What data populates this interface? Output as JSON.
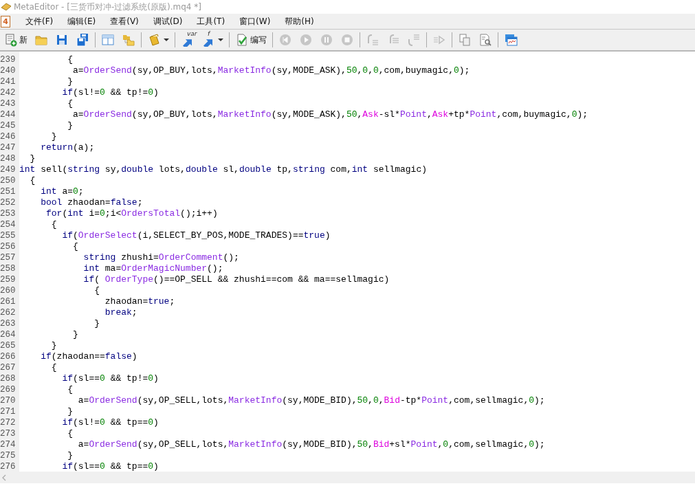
{
  "window": {
    "title": "MetaEditor - [三货币对冲-过滤系统(原版).mq4 *]",
    "active": false
  },
  "menu_bar": {
    "app_icon_text": "4",
    "items": [
      {
        "label": "文件(F)"
      },
      {
        "label": "编辑(E)"
      },
      {
        "label": "查看(V)"
      },
      {
        "label": "调试(D)"
      },
      {
        "label": "工具(T)"
      },
      {
        "label": "窗口(W)"
      },
      {
        "label": "帮助(H)"
      }
    ]
  },
  "toolbar": {
    "groups": [
      [
        {
          "label": "新",
          "disabled": false,
          "dropdown": false
        },
        {
          "disabled": false,
          "dropdown": false
        },
        {
          "disabled": false,
          "dropdown": false
        },
        {
          "disabled": false,
          "dropdown": false
        }
      ],
      [
        {
          "disabled": false,
          "dropdown": false
        },
        {
          "disabled": false,
          "dropdown": false
        }
      ],
      [
        {
          "disabled": false,
          "dropdown": true
        }
      ],
      [
        {
          "icon_text": "var",
          "disabled": false,
          "dropdown": false
        },
        {
          "icon_text": "f",
          "disabled": false,
          "dropdown": true
        }
      ],
      [
        {
          "label": "编写",
          "disabled": false,
          "dropdown": false
        }
      ],
      [
        {
          "disabled": true,
          "dropdown": false
        },
        {
          "disabled": true,
          "dropdown": false
        },
        {
          "disabled": true,
          "dropdown": false
        },
        {
          "disabled": true,
          "dropdown": false
        }
      ],
      [
        {
          "disabled": true,
          "dropdown": false
        },
        {
          "disabled": true,
          "dropdown": false
        },
        {
          "disabled": true,
          "dropdown": false
        }
      ],
      [
        {
          "disabled": true,
          "dropdown": false
        }
      ],
      [
        {
          "disabled": false,
          "dropdown": false
        },
        {
          "disabled": false,
          "dropdown": false
        }
      ],
      [
        {
          "disabled": false,
          "dropdown": false
        }
      ]
    ]
  },
  "editor": {
    "lines": [
      {
        "number": "239",
        "tokens": [
          {
            "kind": "plain",
            "text": "{"
          }
        ]
      },
      {
        "number": "240",
        "tokens": [
          {
            "kind": "plain",
            "text": "a="
          },
          {
            "kind": "function",
            "text": "OrderSend"
          },
          {
            "kind": "plain",
            "text": "(sy,OP_BUY,lots,"
          },
          {
            "kind": "function",
            "text": "MarketInfo"
          },
          {
            "kind": "plain",
            "text": "(sy,MODE_ASK),"
          },
          {
            "kind": "number",
            "text": "50"
          },
          {
            "kind": "plain",
            "text": ","
          },
          {
            "kind": "number",
            "text": "0"
          },
          {
            "kind": "plain",
            "text": ","
          },
          {
            "kind": "number",
            "text": "0"
          },
          {
            "kind": "plain",
            "text": ",com,buymagic,"
          },
          {
            "kind": "number",
            "text": "0"
          },
          {
            "kind": "plain",
            "text": ");"
          }
        ]
      },
      {
        "number": "241",
        "tokens": [
          {
            "kind": "plain",
            "text": "}"
          }
        ]
      },
      {
        "number": "242",
        "tokens": [
          {
            "kind": "keyword",
            "text": "if"
          },
          {
            "kind": "plain",
            "text": "(sl!="
          },
          {
            "kind": "number",
            "text": "0"
          },
          {
            "kind": "plain",
            "text": " && tp!="
          },
          {
            "kind": "number",
            "text": "0"
          },
          {
            "kind": "plain",
            "text": ")"
          }
        ]
      },
      {
        "number": "243",
        "tokens": [
          {
            "kind": "plain",
            "text": "{"
          }
        ]
      },
      {
        "number": "244",
        "tokens": [
          {
            "kind": "plain",
            "text": "a="
          },
          {
            "kind": "function",
            "text": "OrderSend"
          },
          {
            "kind": "plain",
            "text": "(sy,OP_BUY,lots,"
          },
          {
            "kind": "function",
            "text": "MarketInfo"
          },
          {
            "kind": "plain",
            "text": "(sy,MODE_ASK),"
          },
          {
            "kind": "number",
            "text": "50"
          },
          {
            "kind": "plain",
            "text": ","
          },
          {
            "kind": "variable",
            "text": "Ask"
          },
          {
            "kind": "plain",
            "text": "-sl*"
          },
          {
            "kind": "function",
            "text": "Point"
          },
          {
            "kind": "plain",
            "text": ","
          },
          {
            "kind": "variable",
            "text": "Ask"
          },
          {
            "kind": "plain",
            "text": "+tp*"
          },
          {
            "kind": "function",
            "text": "Point"
          },
          {
            "kind": "plain",
            "text": ",com,buymagic,"
          },
          {
            "kind": "number",
            "text": "0"
          },
          {
            "kind": "plain",
            "text": ");"
          }
        ]
      },
      {
        "number": "245",
        "tokens": [
          {
            "kind": "plain",
            "text": "}"
          }
        ]
      },
      {
        "number": "246",
        "tokens": [
          {
            "kind": "plain",
            "text": "}"
          }
        ]
      },
      {
        "number": "247",
        "tokens": [
          {
            "kind": "keyword",
            "text": "return"
          },
          {
            "kind": "plain",
            "text": "(a);"
          }
        ]
      },
      {
        "number": "248",
        "tokens": [
          {
            "kind": "plain",
            "text": "}"
          }
        ]
      },
      {
        "number": "249",
        "tokens": [
          {
            "kind": "keyword",
            "text": "int"
          },
          {
            "kind": "plain",
            "text": " sell("
          },
          {
            "kind": "keyword",
            "text": "string"
          },
          {
            "kind": "plain",
            "text": " sy,"
          },
          {
            "kind": "keyword",
            "text": "double"
          },
          {
            "kind": "plain",
            "text": " lots,"
          },
          {
            "kind": "keyword",
            "text": "double"
          },
          {
            "kind": "plain",
            "text": " sl,"
          },
          {
            "kind": "keyword",
            "text": "double"
          },
          {
            "kind": "plain",
            "text": " tp,"
          },
          {
            "kind": "keyword",
            "text": "string"
          },
          {
            "kind": "plain",
            "text": " com,"
          },
          {
            "kind": "keyword",
            "text": "int"
          },
          {
            "kind": "plain",
            "text": " sellmagic)"
          }
        ]
      },
      {
        "number": "250",
        "tokens": [
          {
            "kind": "plain",
            "text": "{"
          }
        ]
      },
      {
        "number": "251",
        "tokens": [
          {
            "kind": "keyword",
            "text": "int"
          },
          {
            "kind": "plain",
            "text": " a="
          },
          {
            "kind": "number",
            "text": "0"
          },
          {
            "kind": "plain",
            "text": ";"
          }
        ]
      },
      {
        "number": "252",
        "tokens": [
          {
            "kind": "keyword",
            "text": "bool"
          },
          {
            "kind": "plain",
            "text": " zhaodan="
          },
          {
            "kind": "keyword",
            "text": "false"
          },
          {
            "kind": "plain",
            "text": ";"
          }
        ]
      },
      {
        "number": "253",
        "tokens": [
          {
            "kind": "keyword",
            "text": "for"
          },
          {
            "kind": "plain",
            "text": "("
          },
          {
            "kind": "keyword",
            "text": "int"
          },
          {
            "kind": "plain",
            "text": " i="
          },
          {
            "kind": "number",
            "text": "0"
          },
          {
            "kind": "plain",
            "text": ";i<"
          },
          {
            "kind": "function",
            "text": "OrdersTotal"
          },
          {
            "kind": "plain",
            "text": "();i++)"
          }
        ]
      },
      {
        "number": "254",
        "tokens": [
          {
            "kind": "plain",
            "text": "{"
          }
        ]
      },
      {
        "number": "255",
        "tokens": [
          {
            "kind": "keyword",
            "text": "if"
          },
          {
            "kind": "plain",
            "text": "("
          },
          {
            "kind": "function",
            "text": "OrderSelect"
          },
          {
            "kind": "plain",
            "text": "(i,SELECT_BY_POS,MODE_TRADES)=="
          },
          {
            "kind": "keyword",
            "text": "true"
          },
          {
            "kind": "plain",
            "text": ")"
          }
        ]
      },
      {
        "number": "256",
        "tokens": [
          {
            "kind": "plain",
            "text": "{"
          }
        ]
      },
      {
        "number": "257",
        "tokens": [
          {
            "kind": "keyword",
            "text": "string"
          },
          {
            "kind": "plain",
            "text": " zhushi="
          },
          {
            "kind": "function",
            "text": "OrderComment"
          },
          {
            "kind": "plain",
            "text": "();"
          }
        ]
      },
      {
        "number": "258",
        "tokens": [
          {
            "kind": "keyword",
            "text": "int"
          },
          {
            "kind": "plain",
            "text": " ma="
          },
          {
            "kind": "function",
            "text": "OrderMagicNumber"
          },
          {
            "kind": "plain",
            "text": "();"
          }
        ]
      },
      {
        "number": "259",
        "tokens": [
          {
            "kind": "keyword",
            "text": "if"
          },
          {
            "kind": "plain",
            "text": "( "
          },
          {
            "kind": "function",
            "text": "OrderType"
          },
          {
            "kind": "plain",
            "text": "()==OP_SELL && zhushi==com && ma==sellmagic)"
          }
        ]
      },
      {
        "number": "260",
        "tokens": [
          {
            "kind": "plain",
            "text": "{"
          }
        ]
      },
      {
        "number": "261",
        "tokens": [
          {
            "kind": "plain",
            "text": "zhaodan="
          },
          {
            "kind": "keyword",
            "text": "true"
          },
          {
            "kind": "plain",
            "text": ";"
          }
        ]
      },
      {
        "number": "262",
        "tokens": [
          {
            "kind": "keyword",
            "text": "break"
          },
          {
            "kind": "plain",
            "text": ";"
          }
        ]
      },
      {
        "number": "263",
        "tokens": [
          {
            "kind": "plain",
            "text": "}"
          }
        ]
      },
      {
        "number": "264",
        "tokens": [
          {
            "kind": "plain",
            "text": "}"
          }
        ]
      },
      {
        "number": "265",
        "tokens": [
          {
            "kind": "plain",
            "text": "}"
          }
        ]
      },
      {
        "number": "266",
        "tokens": [
          {
            "kind": "keyword",
            "text": "if"
          },
          {
            "kind": "plain",
            "text": "(zhaodan=="
          },
          {
            "kind": "keyword",
            "text": "false"
          },
          {
            "kind": "plain",
            "text": ")"
          }
        ]
      },
      {
        "number": "267",
        "tokens": [
          {
            "kind": "plain",
            "text": "{"
          }
        ]
      },
      {
        "number": "268",
        "tokens": [
          {
            "kind": "keyword",
            "text": "if"
          },
          {
            "kind": "plain",
            "text": "(sl=="
          },
          {
            "kind": "number",
            "text": "0"
          },
          {
            "kind": "plain",
            "text": " && tp!="
          },
          {
            "kind": "number",
            "text": "0"
          },
          {
            "kind": "plain",
            "text": ")"
          }
        ]
      },
      {
        "number": "269",
        "tokens": [
          {
            "kind": "plain",
            "text": "{"
          }
        ]
      },
      {
        "number": "270",
        "tokens": [
          {
            "kind": "plain",
            "text": "a="
          },
          {
            "kind": "function",
            "text": "OrderSend"
          },
          {
            "kind": "plain",
            "text": "(sy,OP_SELL,lots,"
          },
          {
            "kind": "function",
            "text": "MarketInfo"
          },
          {
            "kind": "plain",
            "text": "(sy,MODE_BID),"
          },
          {
            "kind": "number",
            "text": "50"
          },
          {
            "kind": "plain",
            "text": ","
          },
          {
            "kind": "number",
            "text": "0"
          },
          {
            "kind": "plain",
            "text": ","
          },
          {
            "kind": "variable",
            "text": "Bid"
          },
          {
            "kind": "plain",
            "text": "-tp*"
          },
          {
            "kind": "function",
            "text": "Point"
          },
          {
            "kind": "plain",
            "text": ",com,sellmagic,"
          },
          {
            "kind": "number",
            "text": "0"
          },
          {
            "kind": "plain",
            "text": ");"
          }
        ]
      },
      {
        "number": "271",
        "tokens": [
          {
            "kind": "plain",
            "text": "}"
          }
        ]
      },
      {
        "number": "272",
        "tokens": [
          {
            "kind": "keyword",
            "text": "if"
          },
          {
            "kind": "plain",
            "text": "(sl!="
          },
          {
            "kind": "number",
            "text": "0"
          },
          {
            "kind": "plain",
            "text": " && tp=="
          },
          {
            "kind": "number",
            "text": "0"
          },
          {
            "kind": "plain",
            "text": ")"
          }
        ]
      },
      {
        "number": "273",
        "tokens": [
          {
            "kind": "plain",
            "text": "{"
          }
        ]
      },
      {
        "number": "274",
        "tokens": [
          {
            "kind": "plain",
            "text": "a="
          },
          {
            "kind": "function",
            "text": "OrderSend"
          },
          {
            "kind": "plain",
            "text": "(sy,OP_SELL,lots,"
          },
          {
            "kind": "function",
            "text": "MarketInfo"
          },
          {
            "kind": "plain",
            "text": "(sy,MODE_BID),"
          },
          {
            "kind": "number",
            "text": "50"
          },
          {
            "kind": "plain",
            "text": ","
          },
          {
            "kind": "variable",
            "text": "Bid"
          },
          {
            "kind": "plain",
            "text": "+sl*"
          },
          {
            "kind": "function",
            "text": "Point"
          },
          {
            "kind": "plain",
            "text": ","
          },
          {
            "kind": "number",
            "text": "0"
          },
          {
            "kind": "plain",
            "text": ",com,sellmagic,"
          },
          {
            "kind": "number",
            "text": "0"
          },
          {
            "kind": "plain",
            "text": ");"
          }
        ]
      },
      {
        "number": "275",
        "tokens": [
          {
            "kind": "plain",
            "text": "}"
          }
        ]
      },
      {
        "number": "276",
        "tokens": [
          {
            "kind": "keyword",
            "text": "if"
          },
          {
            "kind": "plain",
            "text": "(sl=="
          },
          {
            "kind": "number",
            "text": "0"
          },
          {
            "kind": "plain",
            "text": " && tp=="
          },
          {
            "kind": "number",
            "text": "0"
          },
          {
            "kind": "plain",
            "text": ")"
          }
        ]
      }
    ]
  }
}
